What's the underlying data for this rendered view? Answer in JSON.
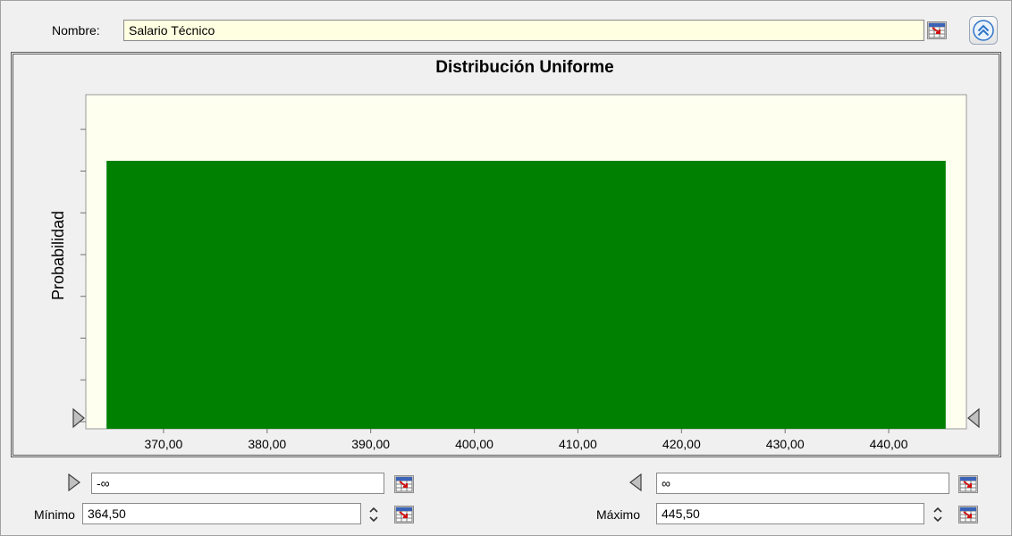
{
  "header": {
    "name_label": "Nombre:",
    "name_value": "Salario Técnico"
  },
  "chart_data": {
    "type": "bar",
    "title": "Distribución Uniforme",
    "ylabel": "Probabilidad",
    "xlabel": "",
    "distribution": "uniform",
    "minimum": 364.5,
    "maximum": 445.5,
    "xlim": [
      362.5,
      447.5
    ],
    "x_ticks": [
      "370,00",
      "380,00",
      "390,00",
      "400,00",
      "410,00",
      "420,00",
      "430,00",
      "440,00"
    ],
    "x_tick_values": [
      370,
      380,
      390,
      400,
      410,
      420,
      430,
      440
    ],
    "y_ticks_count": 8,
    "bar_color": "#008000",
    "plot_background": "#fffff0"
  },
  "lower_bound": {
    "truncation_value": "-∞",
    "label": "Mínimo",
    "value": "364,50"
  },
  "upper_bound": {
    "truncation_value": "∞",
    "label": "Máximo",
    "value": "445,50"
  },
  "icons": {
    "cell_ref": "cell-reference-icon",
    "collapse": "collapse-up-icon",
    "left_marker": "left-truncation-marker-icon",
    "right_marker": "right-truncation-marker-icon",
    "spin": "spin-updown-icon"
  }
}
